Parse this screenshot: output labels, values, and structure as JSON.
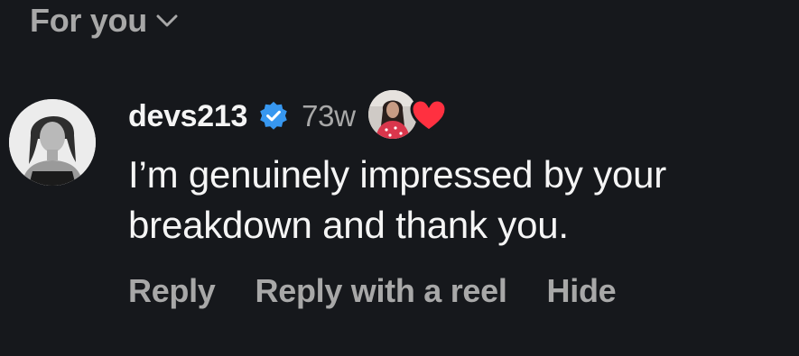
{
  "header": {
    "sort_label": "For you",
    "sort_icon": "chevron-down-icon"
  },
  "comment": {
    "username": "devs213",
    "verified": true,
    "verified_color": "#3797f0",
    "timestamp": "73w",
    "text_line1": "I’m genuinely impressed by your",
    "text_line2": "breakdown and thank you.",
    "liked_by_author": true,
    "heart_color": "#ff3040"
  },
  "actions": {
    "reply_label": "Reply",
    "reply_reel_label": "Reply with a reel",
    "hide_label": "Hide"
  }
}
